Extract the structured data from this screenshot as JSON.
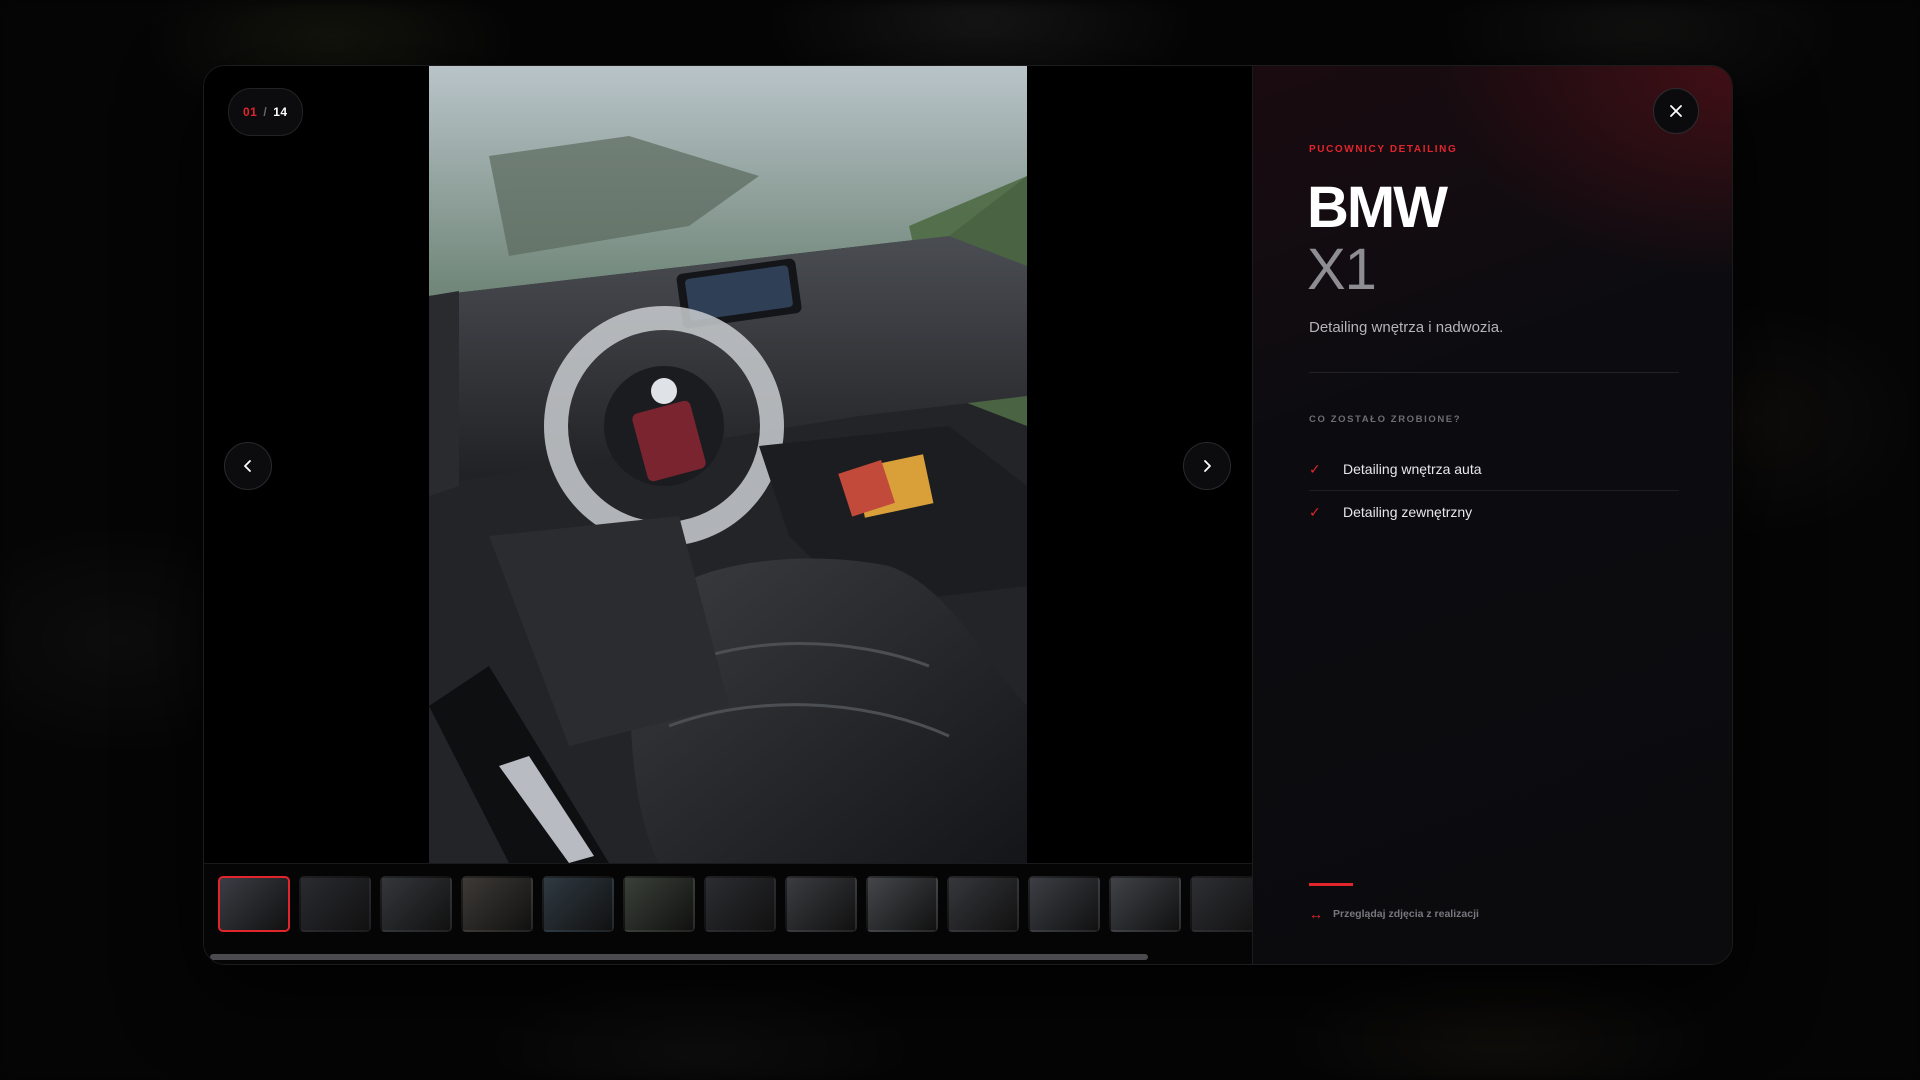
{
  "counter": {
    "current": "01",
    "separator": "/",
    "total": "14"
  },
  "info": {
    "eyebrow": "PUCOWNICY DETAILING",
    "make": "BMW",
    "model": "X1",
    "description": "Detailing wnętrza i nadwozia.",
    "section_label": "CO ZOSTAŁO ZROBIONE?",
    "checklist": [
      "Detailing wnętrza auta",
      "Detailing zewnętrzny"
    ],
    "hint": "Przeglądaj zdjęcia z realizacji"
  },
  "thumbnails": {
    "active_index": 0,
    "colors": [
      "#3a3d44",
      "#2a2b30",
      "#34363a",
      "#3d3a36",
      "#2f3a42",
      "#3a4038",
      "#2c2d31",
      "#3b3c40",
      "#44464a",
      "#36373b",
      "#3c3e44",
      "#404247",
      "#2e2f33"
    ]
  },
  "accent_color": "#e2252d"
}
